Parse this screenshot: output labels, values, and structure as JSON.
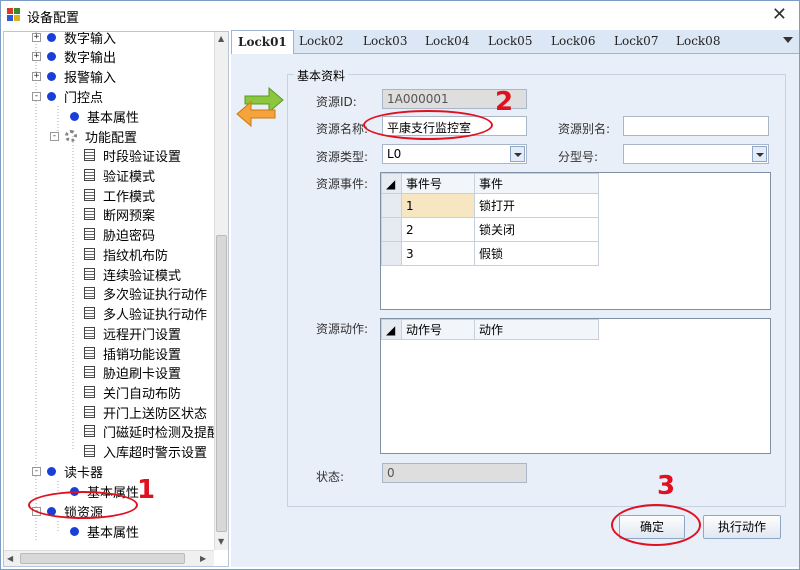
{
  "window": {
    "title": "设备配置"
  },
  "tree": {
    "items": [
      {
        "label": "数字输入",
        "kind": "dot",
        "exp": "+"
      },
      {
        "label": "数字输出",
        "kind": "dot",
        "exp": "+"
      },
      {
        "label": "报警输入",
        "kind": "dot",
        "exp": "+"
      },
      {
        "label": "门控点",
        "kind": "dot",
        "exp": "-"
      },
      {
        "label": "基本属性",
        "kind": "dot"
      },
      {
        "label": "功能配置",
        "kind": "gear",
        "exp": "-"
      },
      {
        "label": "时段验证设置",
        "kind": "doc"
      },
      {
        "label": "验证模式",
        "kind": "doc"
      },
      {
        "label": "工作模式",
        "kind": "doc"
      },
      {
        "label": "断网预案",
        "kind": "doc"
      },
      {
        "label": "胁迫密码",
        "kind": "doc"
      },
      {
        "label": "指纹机布防",
        "kind": "doc"
      },
      {
        "label": "连续验证模式",
        "kind": "doc"
      },
      {
        "label": "多次验证执行动作",
        "kind": "doc"
      },
      {
        "label": "多人验证执行动作",
        "kind": "doc"
      },
      {
        "label": "远程开门设置",
        "kind": "doc"
      },
      {
        "label": "插销功能设置",
        "kind": "doc"
      },
      {
        "label": "胁迫刷卡设置",
        "kind": "doc"
      },
      {
        "label": "关门自动布防",
        "kind": "doc"
      },
      {
        "label": "开门上送防区状态",
        "kind": "doc"
      },
      {
        "label": "门磁延时检测及提醒",
        "kind": "doc"
      },
      {
        "label": "入库超时警示设置",
        "kind": "doc"
      },
      {
        "label": "读卡器",
        "kind": "dot",
        "exp": "-"
      },
      {
        "label": "基本属性",
        "kind": "dot"
      },
      {
        "label": "锁资源",
        "kind": "dot",
        "exp": "-"
      },
      {
        "label": "基本属性",
        "kind": "dot"
      }
    ]
  },
  "tabs": [
    "Lock01",
    "Lock02",
    "Lock03",
    "Lock04",
    "Lock05",
    "Lock06",
    "Lock07",
    "Lock08"
  ],
  "form": {
    "group_title": "基本资料",
    "id_label": "资源ID:",
    "id_value": "1A000001",
    "name_label": "资源名称:",
    "name_value": "平康支行监控室",
    "alias_label": "资源别名:",
    "alias_value": "",
    "type_label": "资源类型:",
    "type_value": "L0",
    "subtype_label": "分型号:",
    "subtype_value": "",
    "events_label": "资源事件:",
    "events_headers": [
      "事件号",
      "事件"
    ],
    "events_rows": [
      [
        "1",
        "锁打开"
      ],
      [
        "2",
        "锁关闭"
      ],
      [
        "3",
        "假锁"
      ]
    ],
    "actions_label": "资源动作:",
    "actions_headers": [
      "动作号",
      "动作"
    ],
    "status_label": "状态:",
    "status_value": "0"
  },
  "buttons": {
    "ok": "确定",
    "execute": "执行动作"
  },
  "annotations": [
    "1",
    "2",
    "3"
  ],
  "colors": {
    "annotation": "#e0101e",
    "tree_dot": "#1a3fd8",
    "tab_bar": "#dce7f5"
  }
}
